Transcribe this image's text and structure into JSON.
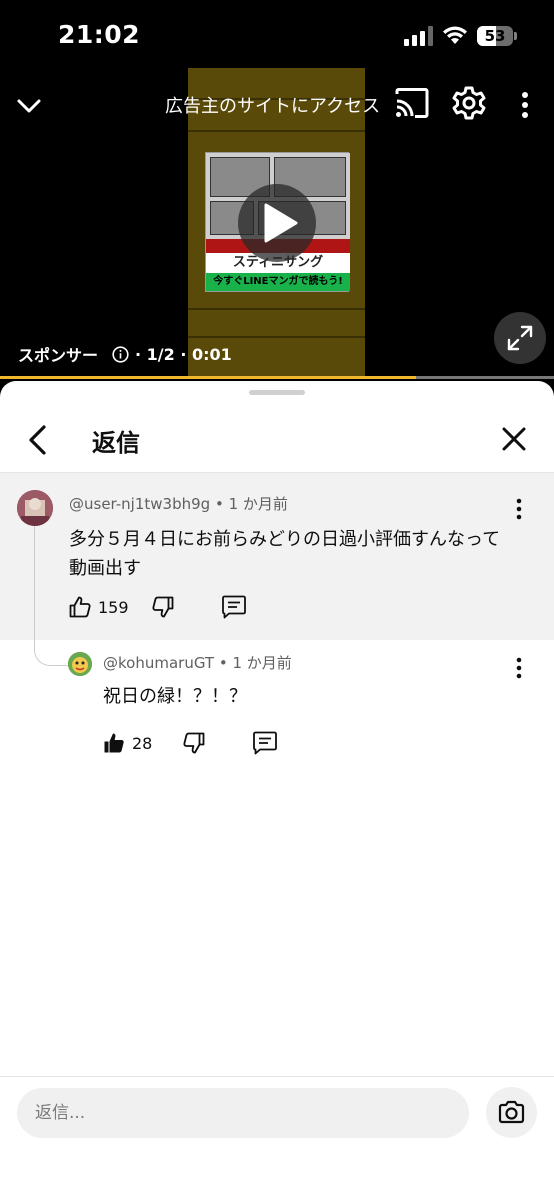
{
  "status_bar": {
    "time": "21:02",
    "battery": "53",
    "battery_level": 0.53
  },
  "video": {
    "ad_link_text": "広告主のサイトにアクセス",
    "sponsor_label": "スポンサー",
    "ad_position": "· 1/2 · 0:01",
    "progress": 0.75,
    "ad_creative": {
      "title": "スティニサング",
      "banner": "今すぐLINEマンガで読もう!"
    },
    "icons": [
      "chevron-down-icon",
      "cast-icon",
      "gear-icon",
      "more-vert-icon",
      "play-icon",
      "info-icon",
      "fullscreen-icon"
    ],
    "accent_color": "#f1b62b"
  },
  "sheet": {
    "title": "返信",
    "parent_comment": {
      "author": "@user-nj1tw3bh9g",
      "time": "1 か月前",
      "text_line1": "多分５月４日にお前らみどりの日過小評価すんなって",
      "text_line2": "動画出す",
      "likes": "159"
    },
    "reply": {
      "author": "@kohumaruGT",
      "time": "1 か月前",
      "text": "祝日の緑！？！？",
      "likes": "28"
    },
    "input": {
      "placeholder": "返信..."
    }
  }
}
